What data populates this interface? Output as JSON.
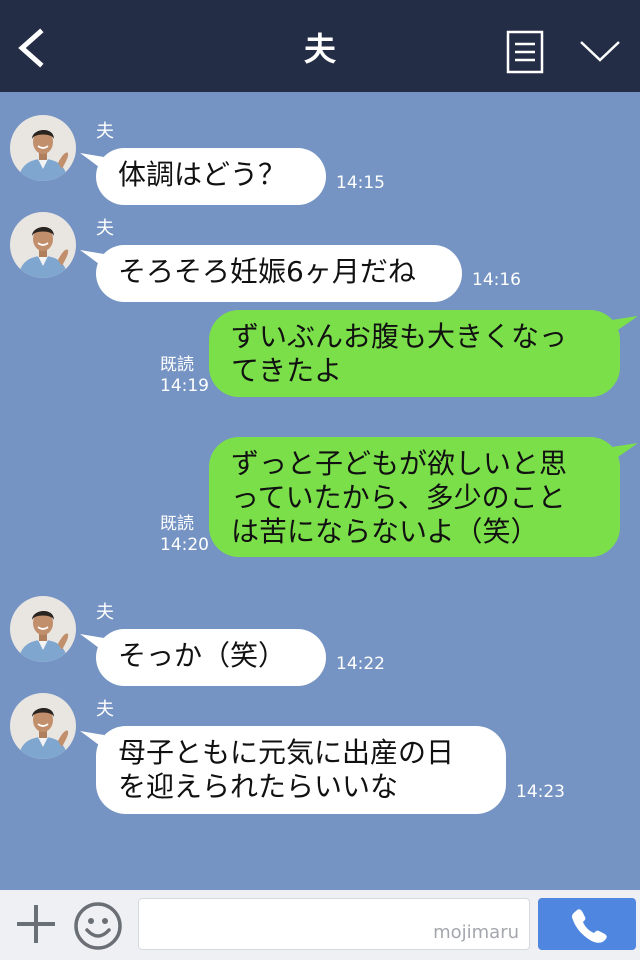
{
  "header": {
    "title": "夫"
  },
  "colors": {
    "header_bg": "#232d46",
    "chat_bg": "#7594c3",
    "incoming_bubble": "#ffffff",
    "outgoing_bubble": "#7bdf4a",
    "call_button": "#4f86e0"
  },
  "icons": {
    "back": "chevron-left-icon",
    "note": "note-icon",
    "more": "chevron-down-icon",
    "plus": "plus-icon",
    "emoji": "smile-icon",
    "call": "phone-icon"
  },
  "messages": [
    {
      "direction": "in",
      "sender": "夫",
      "text": "体調はどう？",
      "time": "14:15"
    },
    {
      "direction": "in",
      "sender": "夫",
      "text": "そろそろ妊娠6ヶ月だね",
      "time": "14:16"
    },
    {
      "direction": "out",
      "read": "既読",
      "text": "ずいぶんお腹も大きくなっ\nてきたよ",
      "time": "14:19"
    },
    {
      "direction": "out",
      "read": "既読",
      "text": "ずっと子どもが欲しいと思\nっていたから、多少のこと\nは苦にならないよ（笑）",
      "time": "14:20"
    },
    {
      "direction": "in",
      "sender": "夫",
      "text": "そっか（笑）",
      "time": "14:22"
    },
    {
      "direction": "in",
      "sender": "夫",
      "text": "母子ともに元気に出産の日\nを迎えられたらいいな",
      "time": "14:23"
    }
  ],
  "footer": {
    "watermark": "mojimaru"
  }
}
